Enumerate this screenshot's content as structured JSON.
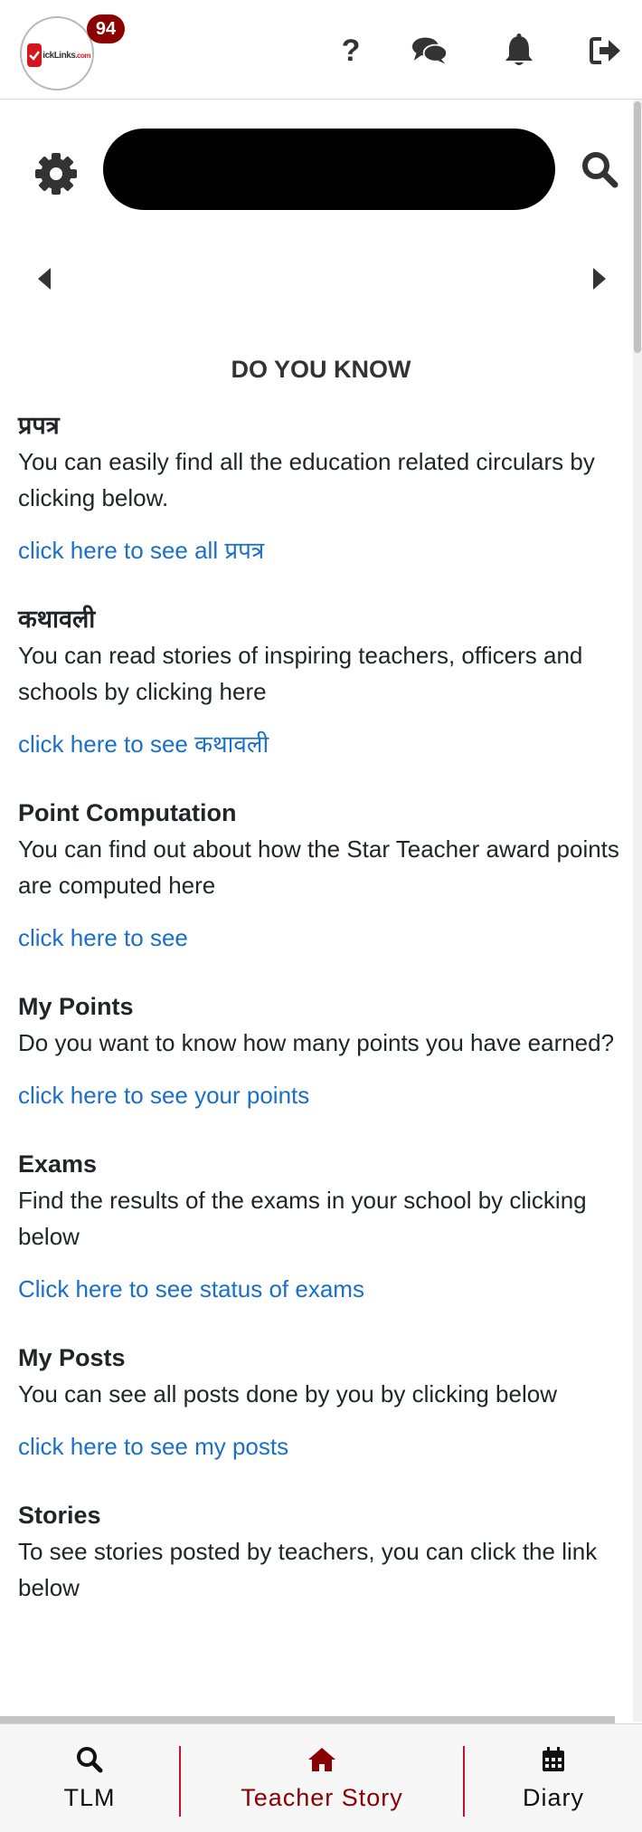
{
  "header": {
    "logo": {
      "text_main": "ickLinks",
      "text_suffix": ".com",
      "badge_count": "94"
    },
    "help_label": "?",
    "icons": [
      "help-icon",
      "chat-icon",
      "bell-icon",
      "logout-icon"
    ]
  },
  "search": {
    "value": "",
    "placeholder": "",
    "icons": [
      "gear-icon",
      "search-icon"
    ]
  },
  "carousel": {
    "icons": [
      "caret-left-icon",
      "caret-right-icon"
    ]
  },
  "content": {
    "heading": "DO YOU KNOW",
    "items": [
      {
        "title": "प्रपत्र",
        "desc": "You can easily find all the education related circulars by clicking below.",
        "link": "click here to see all प्रपत्र"
      },
      {
        "title": "कथावली",
        "desc": "You can read stories of inspiring teachers, officers and schools by clicking here",
        "link": "click here to see कथावली"
      },
      {
        "title": "Point Computation",
        "desc": "You can find out about how the Star Teacher award points are computed here",
        "link": "click here to see"
      },
      {
        "title": "My Points",
        "desc": "Do you want to know how many points you have earned?",
        "link": "click here to see your points"
      },
      {
        "title": "Exams",
        "desc": "Find the results of the exams in your school by clicking below",
        "link": "Click here to see status of exams"
      },
      {
        "title": "My Posts",
        "desc": "You can see all posts done by you by clicking below",
        "link": "click here to see my posts"
      },
      {
        "title": "Stories",
        "desc": "To see stories posted by teachers, you can click the link below",
        "link": ""
      }
    ]
  },
  "bottom_nav": {
    "tlm": "TLM",
    "teacher_story": "Teacher Story",
    "diary": "Diary",
    "active": "teacher_story"
  },
  "colors": {
    "link": "#1a6fc9",
    "badge": "#8b0000",
    "active_nav": "#8b0000",
    "separator": "#c8102e",
    "logo_red": "#d5161e"
  }
}
